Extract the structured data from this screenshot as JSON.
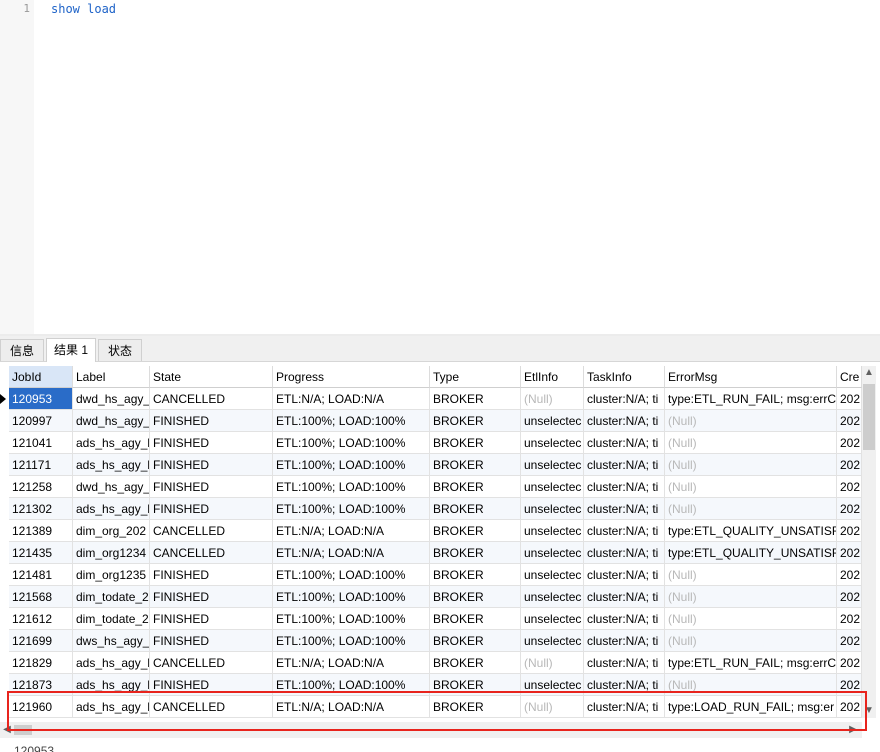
{
  "editor": {
    "line_number": "1",
    "query": "show load"
  },
  "tabs": [
    {
      "label": "信息",
      "active": false
    },
    {
      "label": "结果 1",
      "active": true
    },
    {
      "label": "状态",
      "active": false
    }
  ],
  "table": {
    "columns": [
      "JobId",
      "Label",
      "State",
      "Progress",
      "Type",
      "EtlInfo",
      "TaskInfo",
      "ErrorMsg",
      "Cre"
    ],
    "rows": [
      [
        "120953",
        "dwd_hs_agy_",
        "CANCELLED",
        "ETL:N/A; LOAD:N/A",
        "BROKER",
        "(Null)",
        "cluster:N/A; ti",
        "type:ETL_RUN_FAIL; msg:errC",
        "202"
      ],
      [
        "120997",
        "dwd_hs_agy_",
        "FINISHED",
        "ETL:100%; LOAD:100%",
        "BROKER",
        "unselectec",
        "cluster:N/A; ti",
        "(Null)",
        "202"
      ],
      [
        "121041",
        "ads_hs_agy_k",
        "FINISHED",
        "ETL:100%; LOAD:100%",
        "BROKER",
        "unselectec",
        "cluster:N/A; ti",
        "(Null)",
        "202"
      ],
      [
        "121171",
        "ads_hs_agy_k",
        "FINISHED",
        "ETL:100%; LOAD:100%",
        "BROKER",
        "unselectec",
        "cluster:N/A; ti",
        "(Null)",
        "202"
      ],
      [
        "121258",
        "dwd_hs_agy_",
        "FINISHED",
        "ETL:100%; LOAD:100%",
        "BROKER",
        "unselectec",
        "cluster:N/A; ti",
        "(Null)",
        "202"
      ],
      [
        "121302",
        "ads_hs_agy_k",
        "FINISHED",
        "ETL:100%; LOAD:100%",
        "BROKER",
        "unselectec",
        "cluster:N/A; ti",
        "(Null)",
        "202"
      ],
      [
        "121389",
        "dim_org_202",
        "CANCELLED",
        "ETL:N/A; LOAD:N/A",
        "BROKER",
        "unselectec",
        "cluster:N/A; ti",
        "type:ETL_QUALITY_UNSATISFI",
        "202"
      ],
      [
        "121435",
        "dim_org1234",
        "CANCELLED",
        "ETL:N/A; LOAD:N/A",
        "BROKER",
        "unselectec",
        "cluster:N/A; ti",
        "type:ETL_QUALITY_UNSATISFI",
        "202"
      ],
      [
        "121481",
        "dim_org1235",
        "FINISHED",
        "ETL:100%; LOAD:100%",
        "BROKER",
        "unselectec",
        "cluster:N/A; ti",
        "(Null)",
        "202"
      ],
      [
        "121568",
        "dim_todate_2",
        "FINISHED",
        "ETL:100%; LOAD:100%",
        "BROKER",
        "unselectec",
        "cluster:N/A; ti",
        "(Null)",
        "202"
      ],
      [
        "121612",
        "dim_todate_2",
        "FINISHED",
        "ETL:100%; LOAD:100%",
        "BROKER",
        "unselectec",
        "cluster:N/A; ti",
        "(Null)",
        "202"
      ],
      [
        "121699",
        "dws_hs_agy_l",
        "FINISHED",
        "ETL:100%; LOAD:100%",
        "BROKER",
        "unselectec",
        "cluster:N/A; ti",
        "(Null)",
        "202"
      ],
      [
        "121829",
        "ads_hs_agy_k",
        "CANCELLED",
        "ETL:N/A; LOAD:N/A",
        "BROKER",
        "(Null)",
        "cluster:N/A; ti",
        "type:ETL_RUN_FAIL; msg:errC",
        "202"
      ],
      [
        "121873",
        "ads_hs_agy_k",
        "FINISHED",
        "ETL:100%; LOAD:100%",
        "BROKER",
        "unselectec",
        "cluster:N/A; ti",
        "(Null)",
        "202"
      ],
      [
        "121960",
        "ads_hs_agy_k",
        "CANCELLED",
        "ETL:N/A; LOAD:N/A",
        "BROKER",
        "(Null)",
        "cluster:N/A; ti",
        "type:LOAD_RUN_FAIL; msg:er",
        "202"
      ]
    ],
    "selected_row": 0,
    "highlighted_row": 14,
    "null_text": "(Null)"
  },
  "status_bar": {
    "text": "120953"
  },
  "colors": {
    "selection": "#2a6cc8",
    "highlight_border": "#e8241d",
    "sql_keyword": "#1e63c8",
    "null_text": "#b8b8b8"
  }
}
